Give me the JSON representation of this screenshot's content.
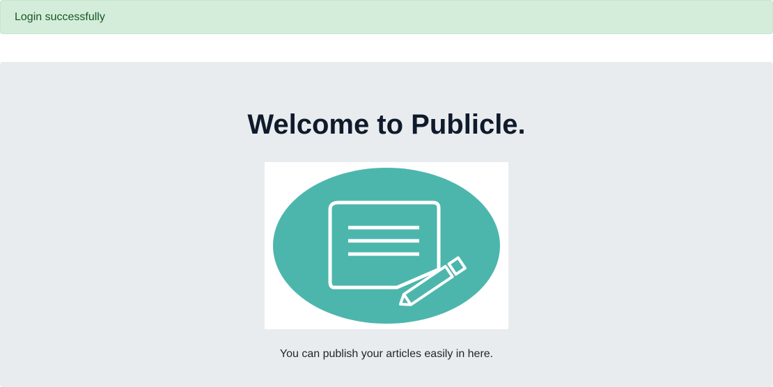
{
  "alert": {
    "message": "Login successfully",
    "background": "#d4edda",
    "text_color": "#155724"
  },
  "hero": {
    "title": "Welcome to Publicle.",
    "description": "You can publish your articles easily in here.",
    "image_icon": "document-edit-icon",
    "image_color": "#4db6ac"
  }
}
